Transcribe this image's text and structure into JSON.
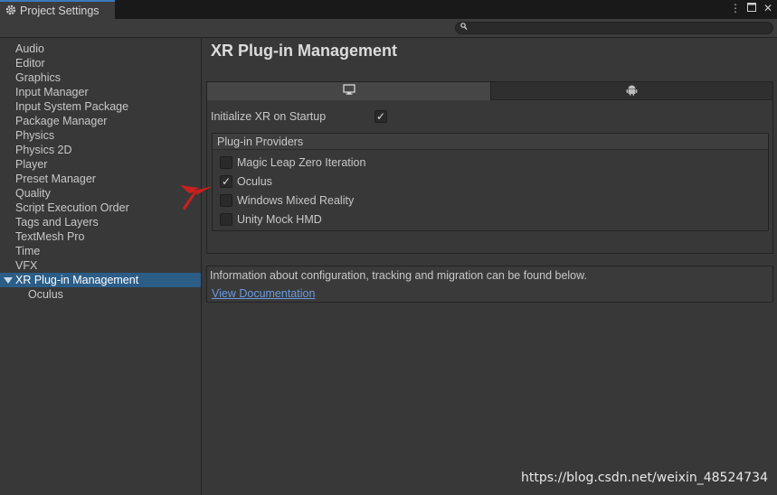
{
  "window": {
    "tab_title": "Project Settings",
    "tab_icon": "gear-icon",
    "buttons": [
      "more-options-icon",
      "maximize-icon",
      "close-icon"
    ]
  },
  "search": {
    "placeholder": "",
    "value": ""
  },
  "sidebar": {
    "items": [
      {
        "label": "Audio"
      },
      {
        "label": "Editor"
      },
      {
        "label": "Graphics"
      },
      {
        "label": "Input Manager"
      },
      {
        "label": "Input System Package"
      },
      {
        "label": "Package Manager"
      },
      {
        "label": "Physics"
      },
      {
        "label": "Physics 2D"
      },
      {
        "label": "Player"
      },
      {
        "label": "Preset Manager"
      },
      {
        "label": "Quality"
      },
      {
        "label": "Script Execution Order"
      },
      {
        "label": "Tags and Layers"
      },
      {
        "label": "TextMesh Pro"
      },
      {
        "label": "Time"
      },
      {
        "label": "VFX"
      },
      {
        "label": "XR Plug-in Management",
        "selected": true,
        "expanded": true
      },
      {
        "label": "Oculus",
        "child": true
      }
    ]
  },
  "main": {
    "title": "XR Plug-in Management",
    "platform_tabs": [
      {
        "icon": "desktop-monitor-icon",
        "active": true
      },
      {
        "icon": "android-icon",
        "active": false
      }
    ],
    "init_xr": {
      "label": "Initialize XR on Startup",
      "checked": true
    },
    "providers": {
      "header": "Plug-in Providers",
      "items": [
        {
          "label": "Magic Leap Zero Iteration",
          "checked": false
        },
        {
          "label": "Oculus",
          "checked": true
        },
        {
          "label": "Windows Mixed Reality",
          "checked": false
        },
        {
          "label": "Unity Mock HMD",
          "checked": false
        }
      ]
    },
    "info": {
      "text": "Information about configuration, tracking and migration can be found below.",
      "link": "View Documentation"
    }
  },
  "watermark": "https://blog.csdn.net/weixin_48524734",
  "colors": {
    "selection": "#2c5d87",
    "link": "#6a9be0",
    "annotation_arrow": "#c8201e"
  }
}
